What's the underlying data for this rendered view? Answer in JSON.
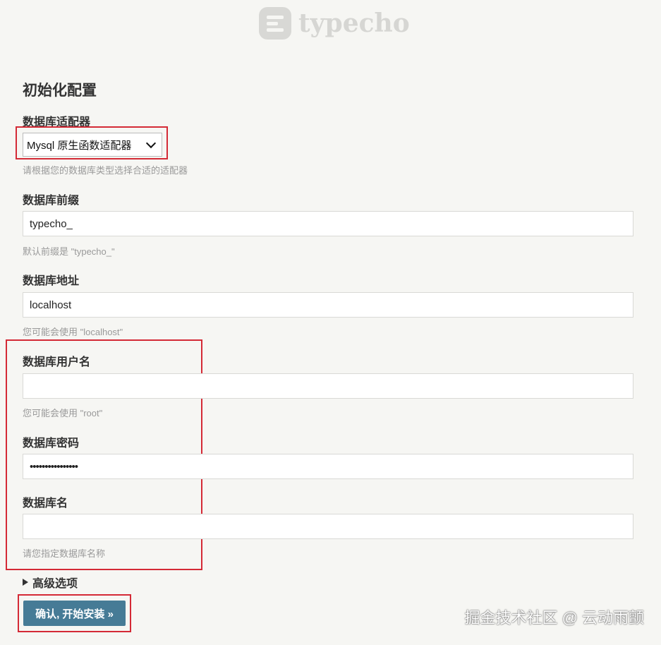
{
  "brand": {
    "name": "typecho",
    "logo_icon": "typecho-logo-icon"
  },
  "section_title": "初始化配置",
  "adapter": {
    "label": "数据库适配器",
    "selected": "Mysql 原生函数适配器",
    "hint": "请根据您的数据库类型选择合适的适配器"
  },
  "prefix": {
    "label": "数据库前缀",
    "value": "typecho_",
    "hint": "默认前缀是 \"typecho_\""
  },
  "host": {
    "label": "数据库地址",
    "value": "localhost",
    "hint": "您可能会使用 \"localhost\""
  },
  "user": {
    "label": "数据库用户名",
    "value": "",
    "hint": "您可能会使用 \"root\""
  },
  "password": {
    "label": "数据库密码",
    "value": "••••••••••••••••"
  },
  "dbname": {
    "label": "数据库名",
    "value": "",
    "hint": "请您指定数据库名称"
  },
  "advanced": {
    "label": "高级选项"
  },
  "submit": {
    "label": "确认, 开始安装 »"
  },
  "watermark": "掘金技术社区 @ 云动雨颤",
  "colors": {
    "accent": "#467b96",
    "highlight": "#d42a36",
    "background": "#f6f6f3"
  }
}
